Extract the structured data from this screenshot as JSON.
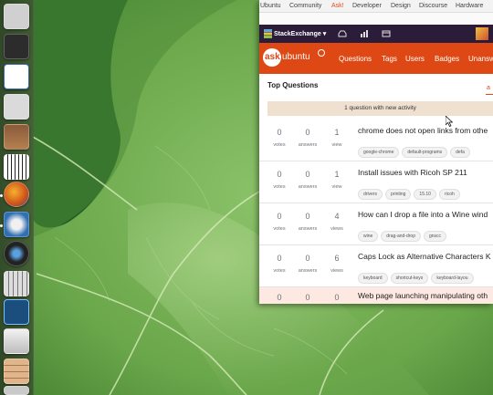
{
  "desktop": {
    "wallpaper": "green-leaf-macro",
    "accent": "#5f9a45"
  },
  "launcher": {
    "icons": [
      {
        "name": "home-folder-icon",
        "color": "#cfcfcf"
      },
      {
        "name": "terminal-icon",
        "color": "#2c2c2c"
      },
      {
        "name": "text-editor-icon",
        "color": "#3a6ea8"
      },
      {
        "name": "files-icon",
        "color": "#d7d7d7"
      },
      {
        "name": "piano-icon-1",
        "color": "#8a5a3a"
      },
      {
        "name": "piano-icon-2",
        "color": "#b37a4c"
      },
      {
        "name": "firefox-icon",
        "color": "#e87a23"
      },
      {
        "name": "thunderbird-icon",
        "color": "#2f6fb3"
      },
      {
        "name": "webcam-icon",
        "color": "#222222"
      },
      {
        "name": "mixer-icon",
        "color": "#d9d9d9"
      },
      {
        "name": "system-monitor-icon",
        "color": "#2e7db5"
      },
      {
        "name": "drive-icon",
        "color": "#e6e6e6"
      },
      {
        "name": "workspace-icon",
        "color": "#c8a27a"
      }
    ]
  },
  "bookmarks": [
    "Ubuntu",
    "Community",
    "Ask!",
    "Developer",
    "Design",
    "Discourse",
    "Hardware"
  ],
  "stackexchange": {
    "label": "StackExchange ▾"
  },
  "header": {
    "logo_ask": "ask",
    "logo_ubuntu": "ubuntu",
    "nav": [
      "Questions",
      "Tags",
      "Users",
      "Badges",
      "Unansw"
    ]
  },
  "content": {
    "heading": "Top Questions",
    "active_tab": "a",
    "activity": "1 question with new activity",
    "questions": [
      {
        "votes": "0",
        "votes_label": "votes",
        "answers": "0",
        "answers_label": "answers",
        "views": "1",
        "views_label": "view",
        "title": "chrome does not open links from othe",
        "tags": [
          "google-chrome",
          "default-programs",
          "defa"
        ]
      },
      {
        "votes": "0",
        "votes_label": "votes",
        "answers": "0",
        "answers_label": "answers",
        "views": "1",
        "views_label": "view",
        "title": "Install issues with Ricoh SP 211",
        "tags": [
          "drivers",
          "printing",
          "15.10",
          "ricoh"
        ]
      },
      {
        "votes": "0",
        "votes_label": "votes",
        "answers": "0",
        "answers_label": "answers",
        "views": "4",
        "views_label": "views",
        "title": "How can I drop a file into a Wine wind",
        "tags": [
          "wine",
          "drag-and-drop",
          "gnscc"
        ]
      },
      {
        "votes": "0",
        "votes_label": "votes",
        "answers": "0",
        "answers_label": "answers",
        "views": "6",
        "views_label": "views",
        "title": "Caps Lock as Alternative Characters K",
        "tags": [
          "keyboard",
          "shortcut-keys",
          "keyboard-layou"
        ]
      },
      {
        "votes": "0",
        "votes_label": "",
        "answers": "0",
        "answers_label": "",
        "views": "0",
        "views_label": "",
        "title": "Web page launching manipulating oth",
        "tags": []
      }
    ]
  }
}
